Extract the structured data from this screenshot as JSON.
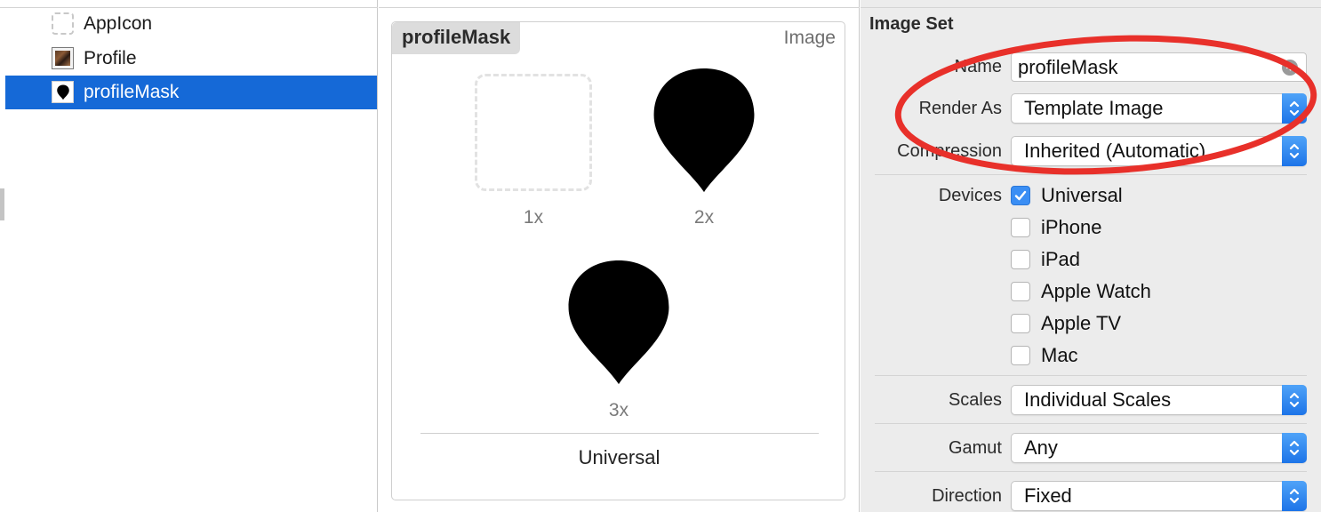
{
  "navigator": {
    "items": [
      {
        "label": "AppIcon",
        "icon": "dashed-placeholder-icon",
        "selected": false
      },
      {
        "label": "Profile",
        "icon": "photo-thumbnail-icon",
        "selected": false
      },
      {
        "label": "profileMask",
        "icon": "teardrop-mask-icon",
        "selected": true
      }
    ]
  },
  "editor": {
    "set_name": "profileMask",
    "set_type": "Image",
    "slots": [
      {
        "scale_label": "1x",
        "filled": false
      },
      {
        "scale_label": "2x",
        "filled": true
      },
      {
        "scale_label": "3x",
        "filled": true
      }
    ],
    "idiom_label": "Universal"
  },
  "inspector": {
    "title": "Image Set",
    "name_label": "Name",
    "name_value": "profileMask",
    "render_as_label": "Render As",
    "render_as_value": "Template Image",
    "compression_label": "Compression",
    "compression_value": "Inherited (Automatic)",
    "devices_label": "Devices",
    "devices": [
      {
        "label": "Universal",
        "checked": true
      },
      {
        "label": "iPhone",
        "checked": false
      },
      {
        "label": "iPad",
        "checked": false
      },
      {
        "label": "Apple Watch",
        "checked": false
      },
      {
        "label": "Apple TV",
        "checked": false
      },
      {
        "label": "Mac",
        "checked": false
      }
    ],
    "scales_label": "Scales",
    "scales_value": "Individual Scales",
    "gamut_label": "Gamut",
    "gamut_value": "Any",
    "direction_label": "Direction",
    "direction_value": "Fixed"
  },
  "colors": {
    "selection": "#1569d7",
    "annotation": "#e8302a",
    "stepper": "#1d74e8"
  }
}
